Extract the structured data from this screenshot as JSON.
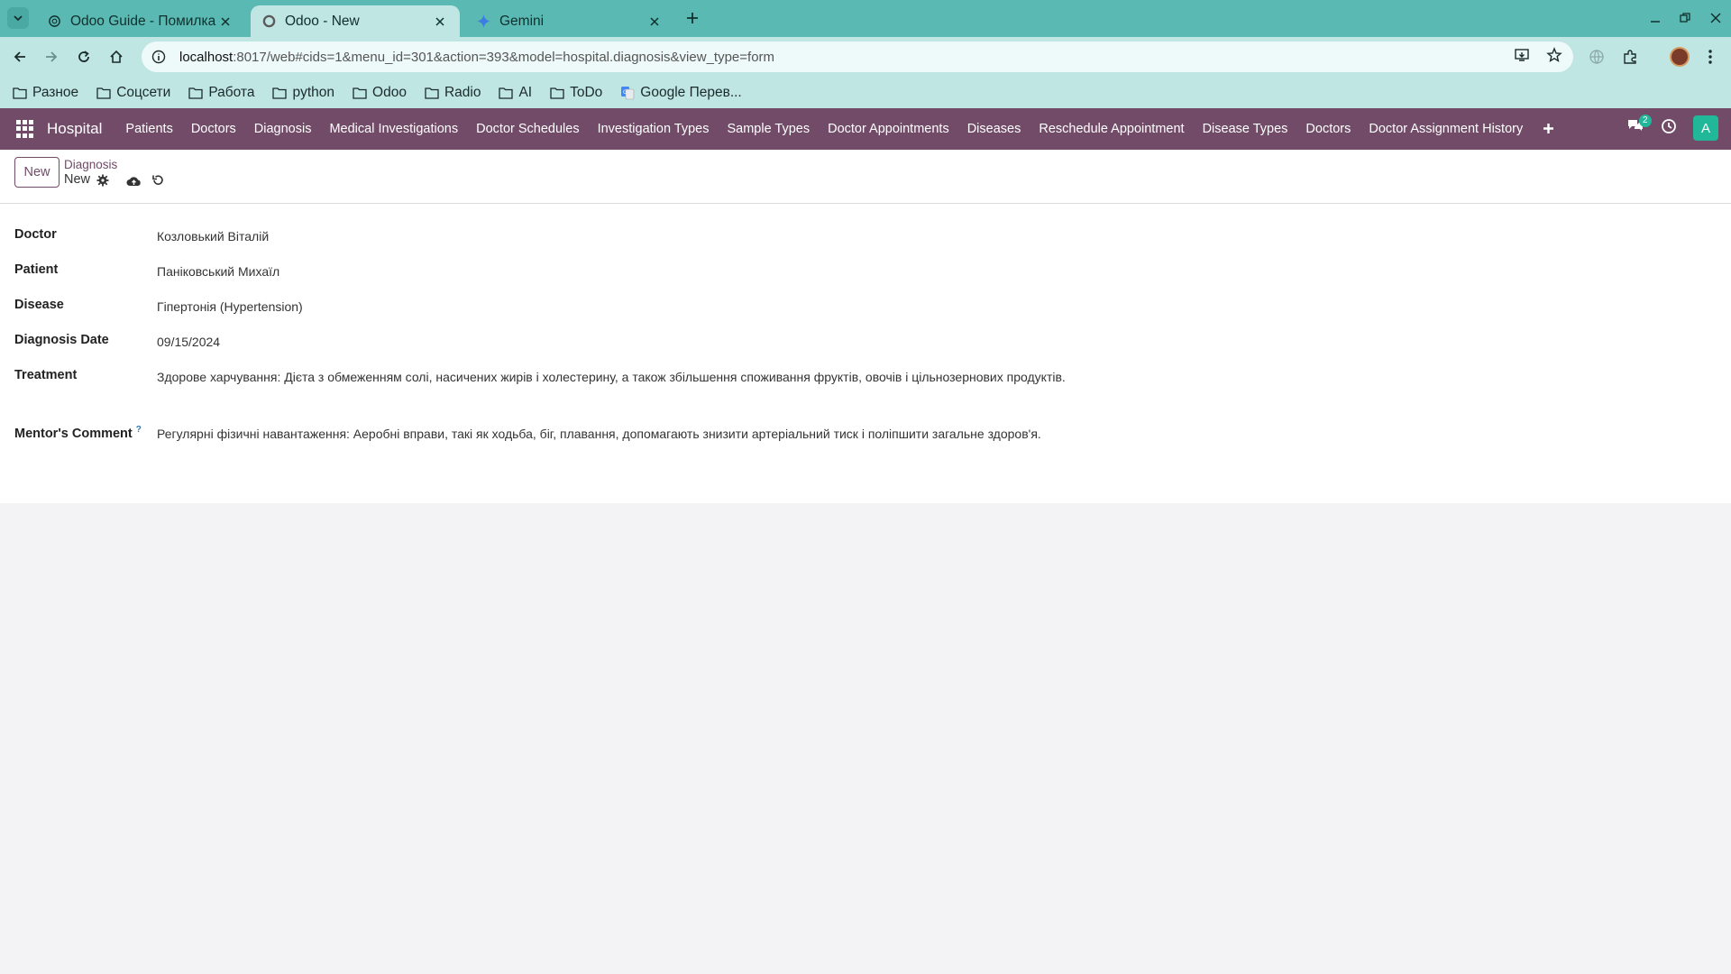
{
  "browser": {
    "tabs": [
      {
        "title": "Odoo Guide - Помилка (",
        "active": false
      },
      {
        "title": "Odoo - New",
        "active": true
      },
      {
        "title": "Gemini",
        "active": false
      }
    ],
    "url_host": "localhost",
    "url_rest": ":8017/web#cids=1&menu_id=301&action=393&model=hospital.diagnosis&view_type=form",
    "bookmarks": [
      "Разное",
      "Соцсети",
      "Работа",
      "python",
      "Odoo",
      "Radio",
      "AI",
      "ToDo",
      "Google Перев..."
    ]
  },
  "odoo": {
    "app_name": "Hospital",
    "menu": [
      "Patients",
      "Doctors",
      "Diagnosis",
      "Medical Investigations",
      "Doctor Schedules",
      "Investigation Types",
      "Sample Types",
      "Doctor Appointments",
      "Diseases",
      "Reschedule Appointment",
      "Disease Types",
      "Doctors",
      "Doctor Assignment History"
    ],
    "messages_count": "2",
    "user_initial": "A",
    "colors": {
      "primary": "#714b67",
      "accent": "#21b799"
    }
  },
  "control_panel": {
    "new_button": "New",
    "breadcrumb_parent": "Diagnosis",
    "breadcrumb_current": "New"
  },
  "form": {
    "doctor_label": "Doctor",
    "doctor_value": "Козловький Віталій",
    "patient_label": "Patient",
    "patient_value": "Паніковський Михаїл",
    "disease_label": "Disease",
    "disease_value": "Гіпертонія (Hypertension)",
    "date_label": "Diagnosis Date",
    "date_value": "09/15/2024",
    "treatment_label": "Treatment",
    "treatment_value": "Здорове харчування: Дієта з обмеженням солі, насичених жирів і холестерину, а також збільшення споживання фруктів, овочів і цільнозернових продуктів.",
    "comment_label": "Mentor's Comment",
    "comment_help": "?",
    "comment_value": "Регулярні фізичні навантаження: Аеробні вправи, такі як ходьба, біг, плавання, допомагають знизити артеріальний тиск і поліпшити загальне здоров'я."
  }
}
